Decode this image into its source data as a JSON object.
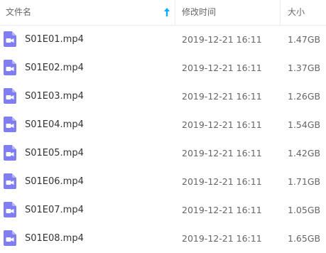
{
  "header": {
    "name_label": "文件名",
    "mtime_label": "修改时间",
    "size_label": "大小",
    "sort_icon": "sort-ascending-arrow-icon"
  },
  "colors": {
    "video_icon": "#7f7ff2",
    "sort_arrow": "#09aaff"
  },
  "files": [
    {
      "name": "S01E01.mp4",
      "mtime": "2019-12-21 16:11",
      "size": "1.47GB",
      "icon": "video-file-icon"
    },
    {
      "name": "S01E02.mp4",
      "mtime": "2019-12-21 16:11",
      "size": "1.37GB",
      "icon": "video-file-icon"
    },
    {
      "name": "S01E03.mp4",
      "mtime": "2019-12-21 16:11",
      "size": "1.26GB",
      "icon": "video-file-icon"
    },
    {
      "name": "S01E04.mp4",
      "mtime": "2019-12-21 16:11",
      "size": "1.54GB",
      "icon": "video-file-icon"
    },
    {
      "name": "S01E05.mp4",
      "mtime": "2019-12-21 16:11",
      "size": "1.42GB",
      "icon": "video-file-icon"
    },
    {
      "name": "S01E06.mp4",
      "mtime": "2019-12-21 16:11",
      "size": "1.71GB",
      "icon": "video-file-icon"
    },
    {
      "name": "S01E07.mp4",
      "mtime": "2019-12-21 16:11",
      "size": "1.05GB",
      "icon": "video-file-icon"
    },
    {
      "name": "S01E08.mp4",
      "mtime": "2019-12-21 16:11",
      "size": "1.65GB",
      "icon": "video-file-icon"
    }
  ]
}
